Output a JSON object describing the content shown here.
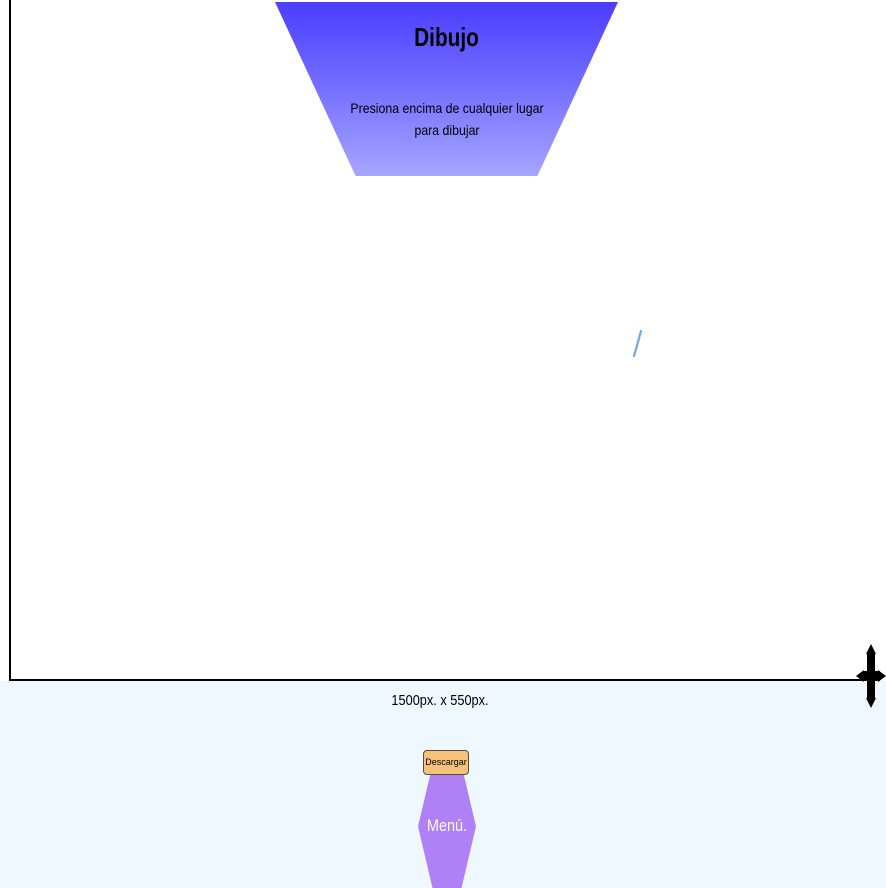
{
  "title_panel": {
    "title": "Dibujo",
    "subtitle": "Presiona encima de cualquier lugar para dibujar"
  },
  "canvas": {
    "size_label": "1500px. x 550px."
  },
  "actions": {
    "download_label": "Descargar",
    "menu_label": "Menú."
  },
  "colors": {
    "panel_top": "#4a3dff",
    "panel_bottom": "#a6a6ff",
    "menu": "#b080f7",
    "download": "#f4c27a",
    "stroke": "#6aa8e8",
    "page_background": "#f0f8ff"
  },
  "icons": {
    "resize_handle": "move-arrows-icon"
  }
}
